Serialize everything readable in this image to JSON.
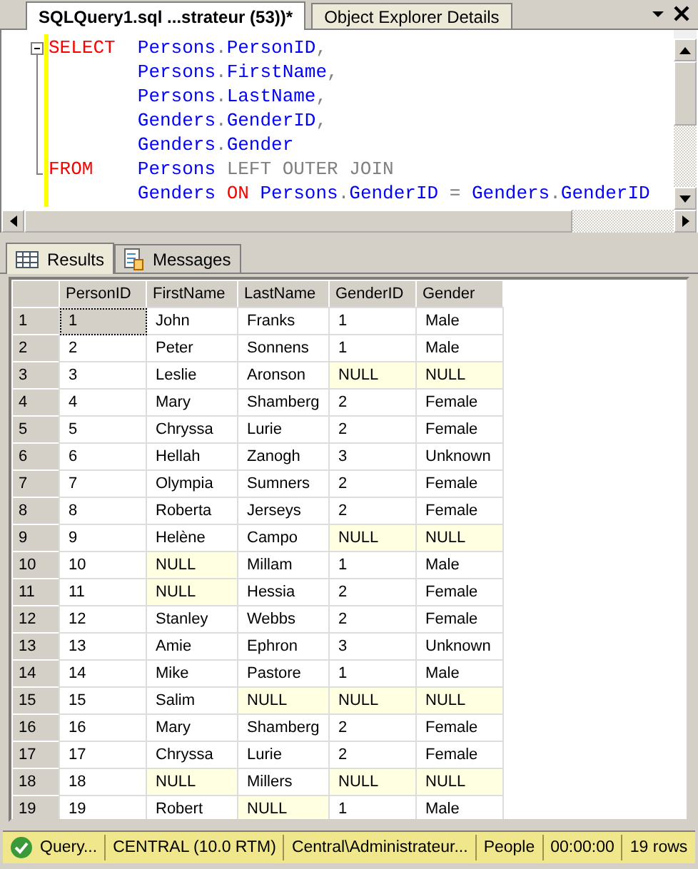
{
  "doc_tabs": [
    {
      "label": "SQLQuery1.sql ...strateur (53))*",
      "selected": true
    },
    {
      "label": "Object Explorer Details",
      "selected": false
    }
  ],
  "editor": {
    "lines": [
      {
        "keyword": "SELECT",
        "tokens": [
          {
            "kind": "ident",
            "text": "Persons"
          },
          {
            "kind": "punct",
            "text": "."
          },
          {
            "kind": "ident",
            "text": "PersonID"
          },
          {
            "kind": "punct",
            "text": ","
          }
        ]
      },
      {
        "tokens": [
          {
            "kind": "ident",
            "text": "Persons"
          },
          {
            "kind": "punct",
            "text": "."
          },
          {
            "kind": "ident",
            "text": "FirstName"
          },
          {
            "kind": "punct",
            "text": ","
          }
        ]
      },
      {
        "tokens": [
          {
            "kind": "ident",
            "text": "Persons"
          },
          {
            "kind": "punct",
            "text": "."
          },
          {
            "kind": "ident",
            "text": "LastName"
          },
          {
            "kind": "punct",
            "text": ","
          }
        ]
      },
      {
        "tokens": [
          {
            "kind": "ident",
            "text": "Genders"
          },
          {
            "kind": "punct",
            "text": "."
          },
          {
            "kind": "ident",
            "text": "GenderID"
          },
          {
            "kind": "punct",
            "text": ","
          }
        ]
      },
      {
        "tokens": [
          {
            "kind": "ident",
            "text": "Genders"
          },
          {
            "kind": "punct",
            "text": "."
          },
          {
            "kind": "ident",
            "text": "Gender"
          }
        ]
      },
      {
        "keyword": "FROM",
        "tokens": [
          {
            "kind": "ident",
            "text": "Persons"
          },
          {
            "kind": "punct",
            "text": " LEFT OUTER JOIN"
          }
        ]
      },
      {
        "tokens": [
          {
            "kind": "ident",
            "text": "Genders"
          },
          {
            "kind": "keyword",
            "text": " ON"
          },
          {
            "kind": "ident",
            "text": " Persons"
          },
          {
            "kind": "punct",
            "text": "."
          },
          {
            "kind": "ident",
            "text": "GenderID"
          },
          {
            "kind": "punct",
            "text": " ="
          },
          {
            "kind": "ident",
            "text": " Genders"
          },
          {
            "kind": "punct",
            "text": "."
          },
          {
            "kind": "ident",
            "text": "GenderID"
          }
        ]
      }
    ]
  },
  "result_tabs": [
    {
      "label": "Results",
      "selected": true
    },
    {
      "label": "Messages",
      "selected": false
    }
  ],
  "grid": {
    "columns": [
      "PersonID",
      "FirstName",
      "LastName",
      "GenderID",
      "Gender"
    ],
    "rows": [
      {
        "header": "1",
        "cells": [
          {
            "text": "1",
            "null": false,
            "selected": true
          },
          {
            "text": "John",
            "null": false,
            "selected": false
          },
          {
            "text": "Franks",
            "null": false,
            "selected": false
          },
          {
            "text": "1",
            "null": false,
            "selected": false
          },
          {
            "text": "Male",
            "null": false,
            "selected": false
          }
        ]
      },
      {
        "header": "2",
        "cells": [
          {
            "text": "2",
            "null": false,
            "selected": false
          },
          {
            "text": "Peter",
            "null": false,
            "selected": false
          },
          {
            "text": "Sonnens",
            "null": false,
            "selected": false
          },
          {
            "text": "1",
            "null": false,
            "selected": false
          },
          {
            "text": "Male",
            "null": false,
            "selected": false
          }
        ]
      },
      {
        "header": "3",
        "cells": [
          {
            "text": "3",
            "null": false,
            "selected": false
          },
          {
            "text": "Leslie",
            "null": false,
            "selected": false
          },
          {
            "text": "Aronson",
            "null": false,
            "selected": false
          },
          {
            "text": "NULL",
            "null": true,
            "selected": false
          },
          {
            "text": "NULL",
            "null": true,
            "selected": false
          }
        ]
      },
      {
        "header": "4",
        "cells": [
          {
            "text": "4",
            "null": false,
            "selected": false
          },
          {
            "text": "Mary",
            "null": false,
            "selected": false
          },
          {
            "text": "Shamberg",
            "null": false,
            "selected": false
          },
          {
            "text": "2",
            "null": false,
            "selected": false
          },
          {
            "text": "Female",
            "null": false,
            "selected": false
          }
        ]
      },
      {
        "header": "5",
        "cells": [
          {
            "text": "5",
            "null": false,
            "selected": false
          },
          {
            "text": "Chryssa",
            "null": false,
            "selected": false
          },
          {
            "text": "Lurie",
            "null": false,
            "selected": false
          },
          {
            "text": "2",
            "null": false,
            "selected": false
          },
          {
            "text": "Female",
            "null": false,
            "selected": false
          }
        ]
      },
      {
        "header": "6",
        "cells": [
          {
            "text": "6",
            "null": false,
            "selected": false
          },
          {
            "text": "Hellah",
            "null": false,
            "selected": false
          },
          {
            "text": "Zanogh",
            "null": false,
            "selected": false
          },
          {
            "text": "3",
            "null": false,
            "selected": false
          },
          {
            "text": "Unknown",
            "null": false,
            "selected": false
          }
        ]
      },
      {
        "header": "7",
        "cells": [
          {
            "text": "7",
            "null": false,
            "selected": false
          },
          {
            "text": "Olympia",
            "null": false,
            "selected": false
          },
          {
            "text": "Sumners",
            "null": false,
            "selected": false
          },
          {
            "text": "2",
            "null": false,
            "selected": false
          },
          {
            "text": "Female",
            "null": false,
            "selected": false
          }
        ]
      },
      {
        "header": "8",
        "cells": [
          {
            "text": "8",
            "null": false,
            "selected": false
          },
          {
            "text": "Roberta",
            "null": false,
            "selected": false
          },
          {
            "text": "Jerseys",
            "null": false,
            "selected": false
          },
          {
            "text": "2",
            "null": false,
            "selected": false
          },
          {
            "text": "Female",
            "null": false,
            "selected": false
          }
        ]
      },
      {
        "header": "9",
        "cells": [
          {
            "text": "9",
            "null": false,
            "selected": false
          },
          {
            "text": "Helène",
            "null": false,
            "selected": false
          },
          {
            "text": "Campo",
            "null": false,
            "selected": false
          },
          {
            "text": "NULL",
            "null": true,
            "selected": false
          },
          {
            "text": "NULL",
            "null": true,
            "selected": false
          }
        ]
      },
      {
        "header": "10",
        "cells": [
          {
            "text": "10",
            "null": false,
            "selected": false
          },
          {
            "text": "NULL",
            "null": true,
            "selected": false
          },
          {
            "text": "Millam",
            "null": false,
            "selected": false
          },
          {
            "text": "1",
            "null": false,
            "selected": false
          },
          {
            "text": "Male",
            "null": false,
            "selected": false
          }
        ]
      },
      {
        "header": "11",
        "cells": [
          {
            "text": "11",
            "null": false,
            "selected": false
          },
          {
            "text": "NULL",
            "null": true,
            "selected": false
          },
          {
            "text": "Hessia",
            "null": false,
            "selected": false
          },
          {
            "text": "2",
            "null": false,
            "selected": false
          },
          {
            "text": "Female",
            "null": false,
            "selected": false
          }
        ]
      },
      {
        "header": "12",
        "cells": [
          {
            "text": "12",
            "null": false,
            "selected": false
          },
          {
            "text": "Stanley",
            "null": false,
            "selected": false
          },
          {
            "text": "Webbs",
            "null": false,
            "selected": false
          },
          {
            "text": "2",
            "null": false,
            "selected": false
          },
          {
            "text": "Female",
            "null": false,
            "selected": false
          }
        ]
      },
      {
        "header": "13",
        "cells": [
          {
            "text": "13",
            "null": false,
            "selected": false
          },
          {
            "text": "Amie",
            "null": false,
            "selected": false
          },
          {
            "text": "Ephron",
            "null": false,
            "selected": false
          },
          {
            "text": "3",
            "null": false,
            "selected": false
          },
          {
            "text": "Unknown",
            "null": false,
            "selected": false
          }
        ]
      },
      {
        "header": "14",
        "cells": [
          {
            "text": "14",
            "null": false,
            "selected": false
          },
          {
            "text": "Mike",
            "null": false,
            "selected": false
          },
          {
            "text": "Pastore",
            "null": false,
            "selected": false
          },
          {
            "text": "1",
            "null": false,
            "selected": false
          },
          {
            "text": "Male",
            "null": false,
            "selected": false
          }
        ]
      },
      {
        "header": "15",
        "cells": [
          {
            "text": "15",
            "null": false,
            "selected": false
          },
          {
            "text": "Salim",
            "null": false,
            "selected": false
          },
          {
            "text": "NULL",
            "null": true,
            "selected": false
          },
          {
            "text": "NULL",
            "null": true,
            "selected": false
          },
          {
            "text": "NULL",
            "null": true,
            "selected": false
          }
        ]
      },
      {
        "header": "16",
        "cells": [
          {
            "text": "16",
            "null": false,
            "selected": false
          },
          {
            "text": "Mary",
            "null": false,
            "selected": false
          },
          {
            "text": "Shamberg",
            "null": false,
            "selected": false
          },
          {
            "text": "2",
            "null": false,
            "selected": false
          },
          {
            "text": "Female",
            "null": false,
            "selected": false
          }
        ]
      },
      {
        "header": "17",
        "cells": [
          {
            "text": "17",
            "null": false,
            "selected": false
          },
          {
            "text": "Chryssa",
            "null": false,
            "selected": false
          },
          {
            "text": "Lurie",
            "null": false,
            "selected": false
          },
          {
            "text": "2",
            "null": false,
            "selected": false
          },
          {
            "text": "Female",
            "null": false,
            "selected": false
          }
        ]
      },
      {
        "header": "18",
        "cells": [
          {
            "text": "18",
            "null": false,
            "selected": false
          },
          {
            "text": "NULL",
            "null": true,
            "selected": false
          },
          {
            "text": "Millers",
            "null": false,
            "selected": false
          },
          {
            "text": "NULL",
            "null": true,
            "selected": false
          },
          {
            "text": "NULL",
            "null": true,
            "selected": false
          }
        ]
      },
      {
        "header": "19",
        "cells": [
          {
            "text": "19",
            "null": false,
            "selected": false
          },
          {
            "text": "Robert",
            "null": false,
            "selected": false
          },
          {
            "text": "NULL",
            "null": true,
            "selected": false
          },
          {
            "text": "1",
            "null": false,
            "selected": false
          },
          {
            "text": "Male",
            "null": false,
            "selected": false
          }
        ]
      }
    ]
  },
  "status_bar": [
    "Query...",
    "CENTRAL (10.0 RTM)",
    "Central\\Administrateur...",
    "People",
    "00:00:00",
    "19 rows"
  ]
}
